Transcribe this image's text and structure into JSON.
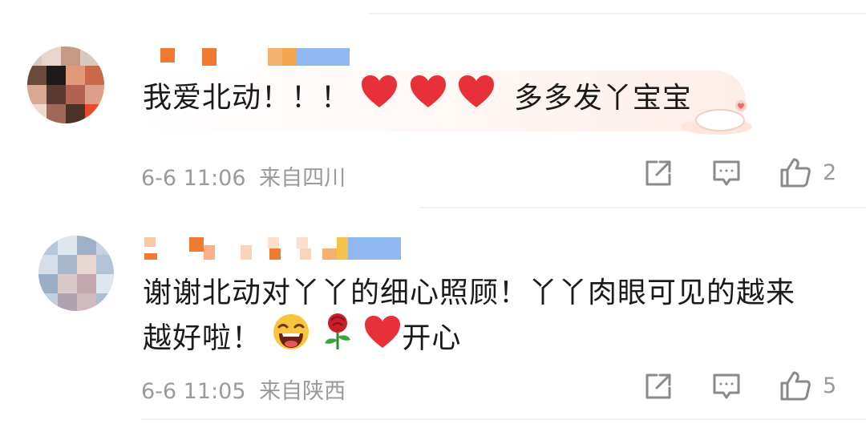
{
  "comments": [
    {
      "text": "我爱北动！！！",
      "text_suffix": "多多发丫宝宝",
      "date": "6-6 11:06",
      "location": "来自四川",
      "like_count": "2"
    },
    {
      "text_line1": "谢谢北动对丫丫的细心照顾！丫丫肉眼可见的越来",
      "text_line2_prefix": "越好啦！",
      "text_line2_suffix": "开心",
      "date": "6-6 11:05",
      "location": "来自陕西",
      "like_count": "5"
    }
  ],
  "icons": {
    "share": "share-icon",
    "comment": "comment-icon",
    "like": "thumbs-up-icon",
    "heart": "heart-emoji",
    "laugh": "laughing-emoji",
    "rose": "rose-emoji",
    "sticker": "cat-sticker"
  },
  "colors": {
    "text": "#1a1a1a",
    "meta": "#9a9a9a",
    "heart": "#e8303a",
    "divider": "#f0f0f0"
  }
}
